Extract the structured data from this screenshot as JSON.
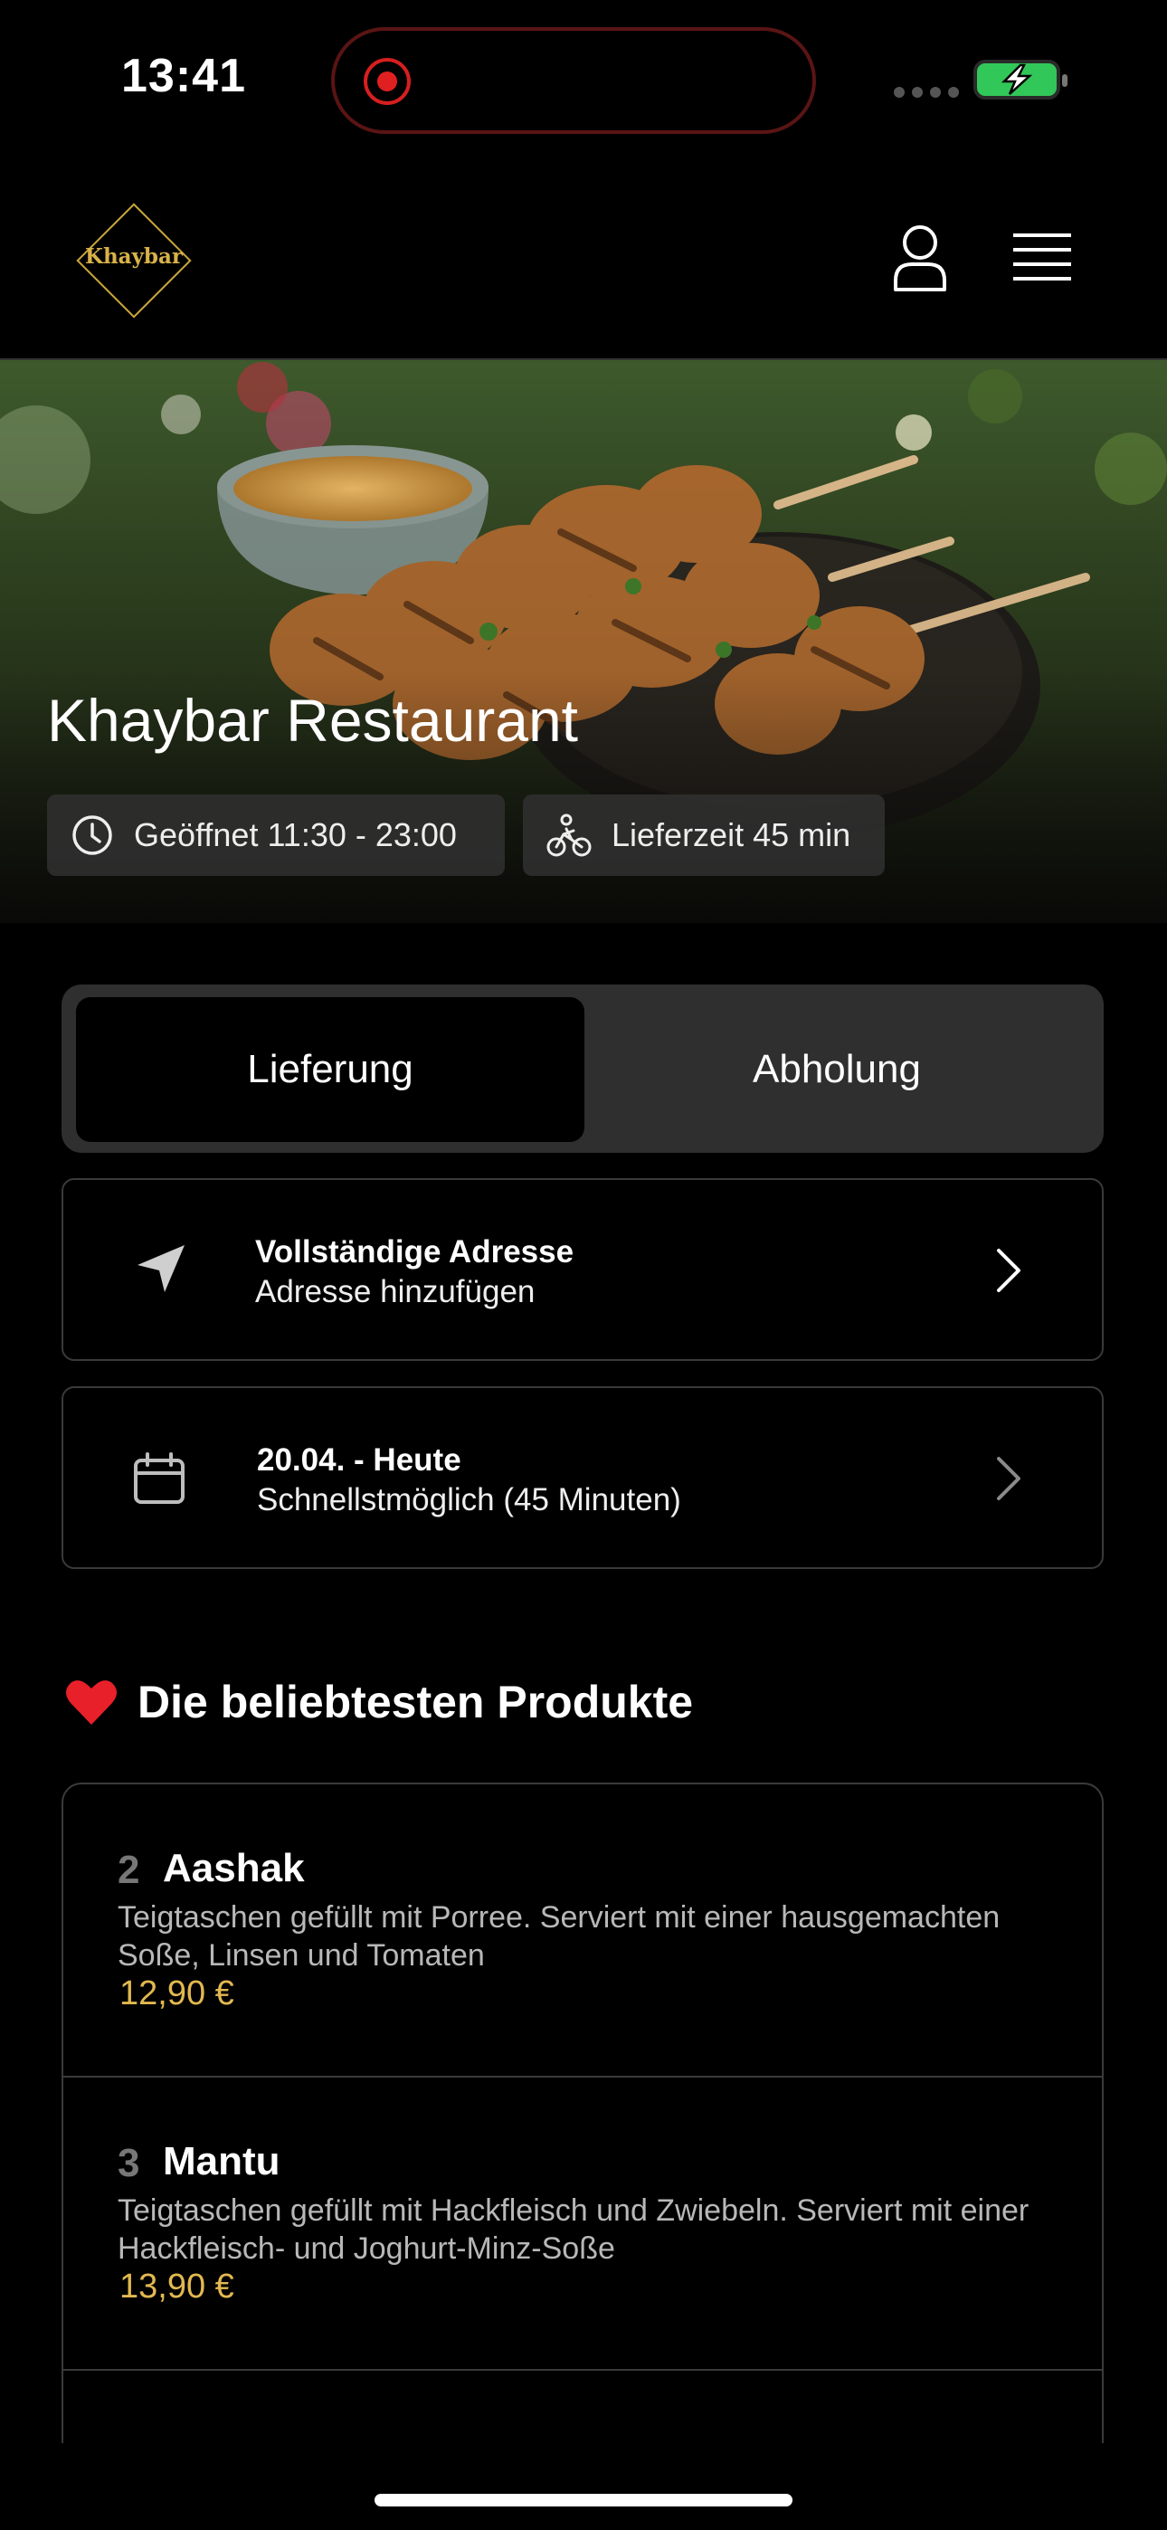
{
  "status_bar": {
    "time": "13:41"
  },
  "header": {
    "logo_text": "Khaybar"
  },
  "hero": {
    "title": "Khaybar Restaurant",
    "open_hours": "Geöffnet 11:30 - 23:00",
    "delivery_time": "Lieferzeit 45 min"
  },
  "mode_toggle": {
    "delivery": "Lieferung",
    "pickup": "Abholung",
    "selected": "Lieferung"
  },
  "address": {
    "title": "Vollständige Adresse",
    "subtitle": "Adresse hinzufügen"
  },
  "schedule": {
    "title": "20.04. - Heute",
    "subtitle": "Schnellstmöglich (45 Minuten)"
  },
  "popular": {
    "title": "Die beliebtesten Produkte",
    "items": [
      {
        "number": "2",
        "name": "Aashak",
        "description": "Teigtaschen gefüllt mit Porree. Serviert mit einer hausgemachten Soße, Linsen und Tomaten",
        "price": "12,90 €"
      },
      {
        "number": "3",
        "name": "Mantu",
        "description": "Teigtaschen gefüllt mit Hackfleisch und Zwiebeln. Serviert mit einer Hackfleisch- und Joghurt-Minz-Soße",
        "price": "13,90 €"
      }
    ]
  },
  "colors": {
    "accent": "#e2b850",
    "battery": "#32c759",
    "recording": "#e02020"
  }
}
